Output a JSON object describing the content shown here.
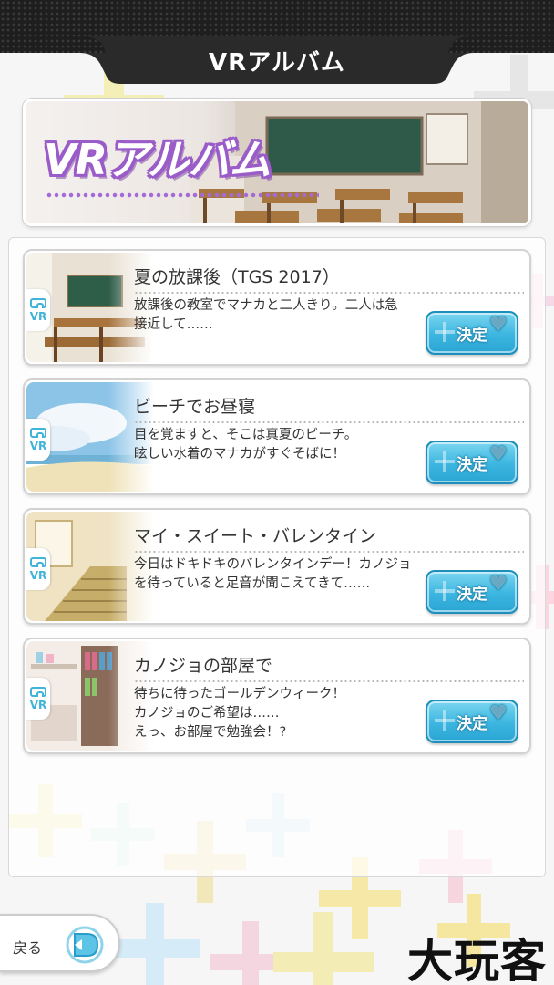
{
  "header": {
    "title": "VRアルバム"
  },
  "banner": {
    "title": "VRアルバム"
  },
  "items": [
    {
      "title": "夏の放課後（TGS 2017）",
      "description": "放課後の教室でマナカと二人きり。二人は急\n接近して……",
      "badge": "VR",
      "button": "決定"
    },
    {
      "title": "ビーチでお昼寝",
      "description": "目を覚ますと、そこは真夏のビーチ。\n眩しい水着のマナカがすぐそばに！",
      "badge": "VR",
      "button": "決定"
    },
    {
      "title": "マイ・スイート・バレンタイン",
      "description": "今日はドキドキのバレンタインデー！カノジョ\nを待っていると足音が聞こえてきて……",
      "badge": "VR",
      "button": "決定"
    },
    {
      "title": "カノジョの部屋で",
      "description": "待ちに待ったゴールデンウィーク！\nカノジョのご希望は……\nえっ、お部屋で勉強会！?",
      "badge": "VR",
      "button": "決定"
    }
  ],
  "footer": {
    "back_label": "戻る",
    "watermark": "大玩客"
  },
  "colors": {
    "accent_blue": "#3cb6e0",
    "banner_purple": "#9a5cc8",
    "header_dark": "#2a2a2a"
  }
}
